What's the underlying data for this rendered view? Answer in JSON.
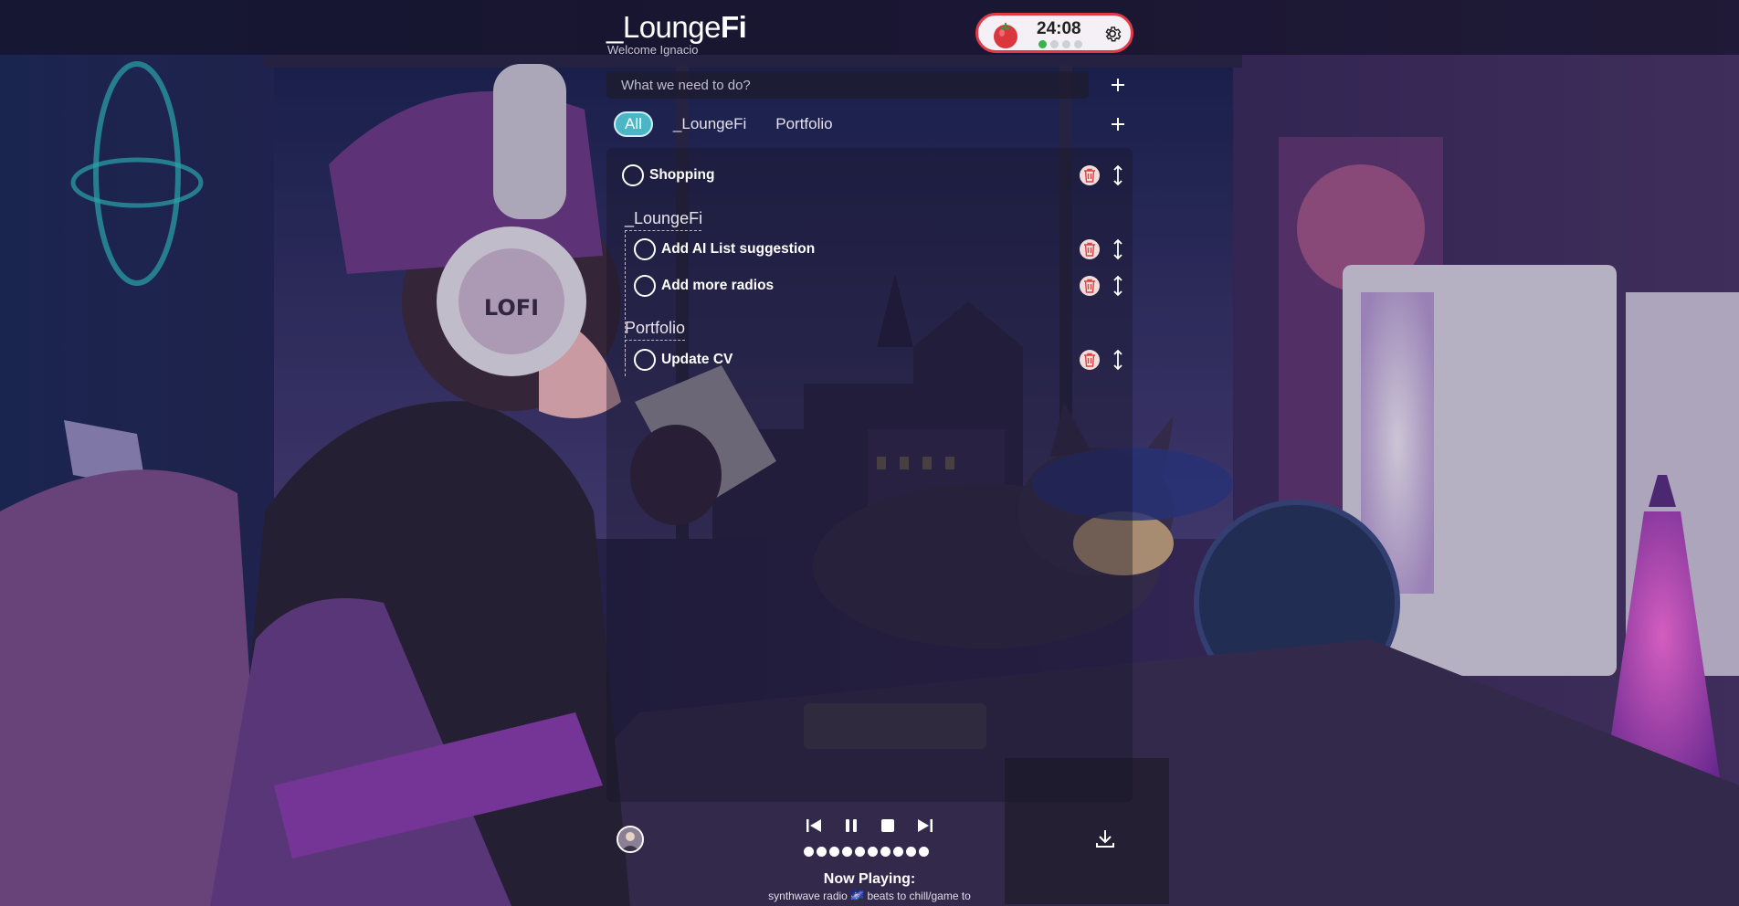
{
  "app": {
    "name_prefix": "_Lounge",
    "name_suffix": "Fi",
    "welcome": "Welcome Ignacio"
  },
  "pomodoro": {
    "time": "24:08",
    "sessions_total": 4,
    "sessions_done": 1,
    "accent": "#e03a47",
    "done_color": "#38b54a"
  },
  "todo": {
    "placeholder": "What we need to do?",
    "value": ""
  },
  "tabs": [
    {
      "label": "All",
      "active": true
    },
    {
      "label": "_LoungeFi",
      "active": false
    },
    {
      "label": "Portfolio",
      "active": false
    }
  ],
  "tasks": {
    "ungrouped": [
      {
        "label": "Shopping",
        "done": false
      }
    ],
    "groups": [
      {
        "title": "_LoungeFi",
        "items": [
          {
            "label": "Add AI List suggestion",
            "done": false
          },
          {
            "label": "Add more radios",
            "done": false
          }
        ]
      },
      {
        "title": "Portfolio",
        "items": [
          {
            "label": "Update CV",
            "done": false
          }
        ]
      }
    ]
  },
  "player": {
    "now_playing_label": "Now Playing:",
    "track": "synthwave radio 🌌 beats to chill/game to",
    "volume_steps": 10,
    "icons": [
      "previous-icon",
      "pause-icon",
      "stop-icon",
      "next-icon",
      "download-icon"
    ]
  },
  "colors": {
    "tab_active": "#4bb6c6",
    "trash_icon": "#d64545"
  }
}
